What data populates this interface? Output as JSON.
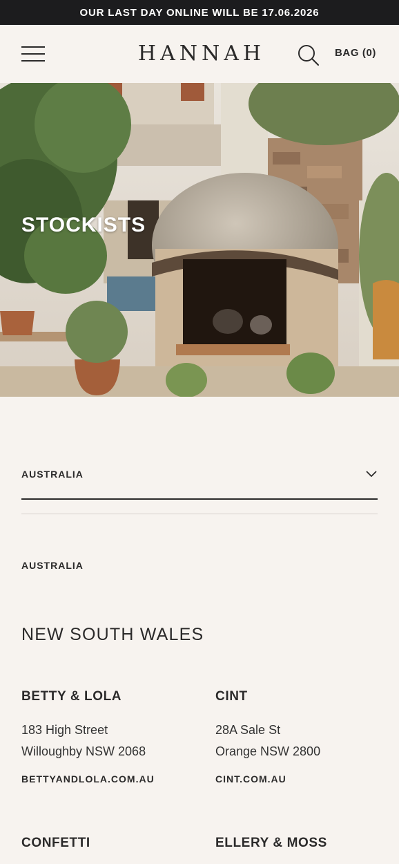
{
  "announcement": "OUR LAST DAY ONLINE WILL BE 17.06.2026",
  "header": {
    "logo": "HANNAH",
    "bag_label": "BAG (0)"
  },
  "hero": {
    "title": "STOCKISTS"
  },
  "country_select": {
    "selected": "AUSTRALIA"
  },
  "country_heading": "AUSTRALIA",
  "region_heading": "NEW SOUTH WALES",
  "stockists": [
    {
      "name": "BETTY & LOLA",
      "address_line1": "183 High Street",
      "address_line2": "Willoughby NSW 2068",
      "website": "BETTYANDLOLA.COM.AU"
    },
    {
      "name": "CINT",
      "address_line1": "28A Sale St",
      "address_line2": "Orange NSW 2800",
      "website": "CINT.COM.AU"
    },
    {
      "name": "CONFETTI"
    },
    {
      "name": "ELLERY & MOSS"
    }
  ],
  "colors": {
    "background": "#f7f3ef",
    "announcement_bg": "#1c1c1e",
    "text": "#2b2a2a"
  }
}
